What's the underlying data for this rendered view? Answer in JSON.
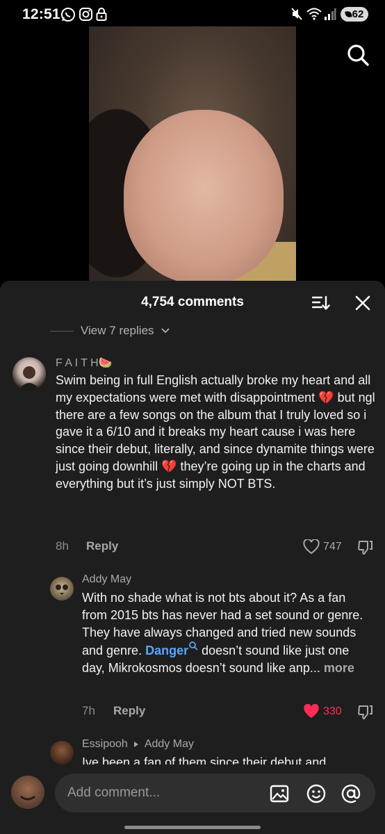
{
  "status_bar": {
    "time": "12:51",
    "left_icons": [
      "whatsapp-icon",
      "instagram-icon",
      "lock-icon"
    ],
    "right_icons": [
      "mute-icon",
      "wifi-icon",
      "signal-icon"
    ],
    "battery": "62"
  },
  "comments_panel": {
    "title": "4,754 comments",
    "view_replies_label": "View 7 replies"
  },
  "comments": [
    {
      "author": "F A I T H🍉",
      "text": "Swim being in full English actually broke my heart and all my expectations were met with disappointment 💔 but ngl there are a few songs on the album that I truly loved so i gave it a 6/10 and it breaks my heart cause i was here since their debut, literally, and since dynamite things were just going downhill 💔 they’re going up in the charts and everything but it’s just simply NOT BTS.",
      "time": "8h",
      "reply_label": "Reply",
      "likes": "747",
      "liked": false
    },
    {
      "author": "Addy May",
      "text_before_link": "With no shade what is not bts about it? As a fan from 2015 bts has never had a set sound or genre. They have always changed and tried new sounds and genre. ",
      "link": "Danger",
      "text_after_link": " doesn’t sound like just one day, Mikrokosmos doesn’t sound like anp...",
      "more_label": "more",
      "time": "7h",
      "reply_label": "Reply",
      "likes": "330",
      "liked": true
    },
    {
      "author": "Essipooh",
      "reply_to": "Addy May",
      "text": "Ive been a fan of them since their debut and"
    }
  ],
  "composer": {
    "placeholder": "Add comment...",
    "icons": [
      "image-icon",
      "emoji-icon",
      "mention-icon"
    ]
  },
  "colors": {
    "sheet_bg": "#1e1e1e",
    "link": "#56a8ff",
    "liked_heart": "#ff2d55"
  }
}
